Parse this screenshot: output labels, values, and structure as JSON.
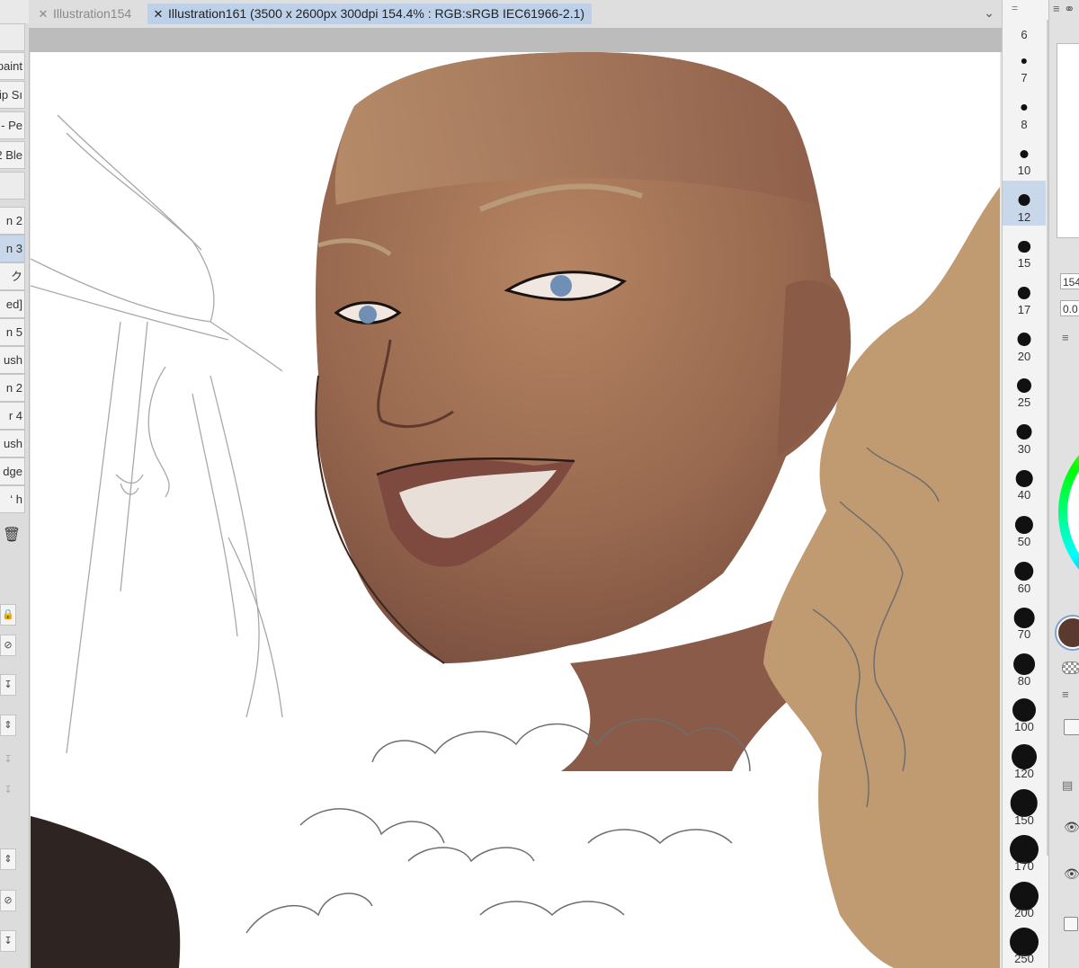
{
  "tabs": [
    {
      "label": "Illustration154",
      "active": false
    },
    {
      "label": "Illustration161 (3500 x 2600px 300dpi 154.4% : RGB:sRGB IEC61966-2.1)",
      "active": true
    }
  ],
  "tabs_menu_icon": "chevron-down-icon",
  "left_panel": {
    "sub_tools": [
      {
        "label": "",
        "selected": false
      },
      {
        "label": "paint",
        "selected": false
      },
      {
        "label": "ip Sı",
        "selected": false
      },
      {
        "label": "- Pe",
        "selected": false
      },
      {
        "label": "2 Ble",
        "selected": false
      },
      {
        "label": "",
        "selected": false
      },
      {
        "label": "n 2",
        "selected": false
      },
      {
        "label": "n 3",
        "selected": true
      },
      {
        "label": "ク",
        "selected": false
      },
      {
        "label": "ed]",
        "selected": false
      },
      {
        "label": "n 5",
        "selected": false
      },
      {
        "label": "ush",
        "selected": false
      },
      {
        "label": "n 2",
        "selected": false
      },
      {
        "label": "r 4",
        "selected": false
      },
      {
        "label": "ush",
        "selected": false
      },
      {
        "label": "dge",
        "selected": false
      },
      {
        "label": "‘ h",
        "selected": false
      }
    ],
    "delete_icon": "trash-icon"
  },
  "brush_sizes": {
    "header": "=",
    "selected": 12,
    "sizes": [
      6,
      7,
      8,
      10,
      12,
      15,
      17,
      20,
      25,
      30,
      40,
      50,
      60,
      70,
      80,
      100,
      120,
      150,
      170,
      200,
      250
    ]
  },
  "right_panel": {
    "zoom_value": "154",
    "rotation_value": "0.0",
    "main_color": "#5a3a2e"
  },
  "colors": {
    "tab_active_bg": "#bcd0e8",
    "selection_bg": "#c9d7ea",
    "canvas_border": "#bcbcbc"
  }
}
